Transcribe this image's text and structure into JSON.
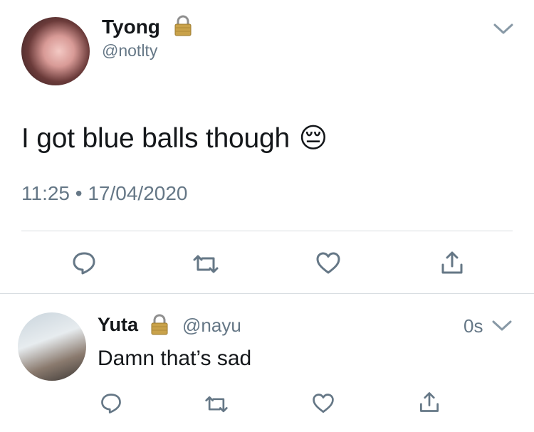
{
  "main_tweet": {
    "author_name": "Tyong",
    "author_handle": "@notlty",
    "text": "I got blue balls though",
    "emoji": "😔",
    "timestamp": "11:25 • 17/04/2020"
  },
  "reply": {
    "author_name": "Yuta",
    "author_handle": "@nayu",
    "text": "Damn that’s sad",
    "time": "0s"
  },
  "icons": {
    "lock": "lock-icon",
    "menu": "chevron-down-icon",
    "reply": "reply-bubble-icon",
    "retweet": "retweet-icon",
    "like": "heart-icon",
    "share": "share-icon"
  },
  "colors": {
    "text": "#14171a",
    "secondary": "#657786",
    "divider": "#d8dde1"
  }
}
